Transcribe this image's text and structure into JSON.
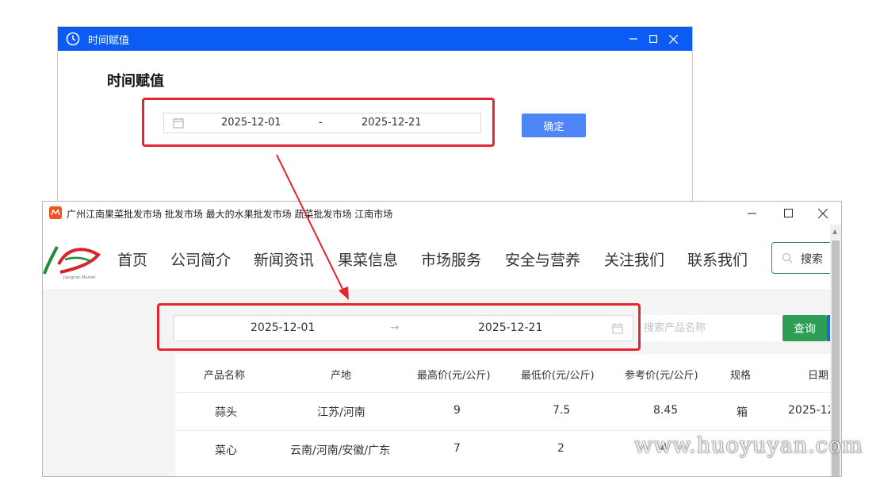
{
  "dialog": {
    "title": "时间赋值",
    "heading": "时间赋值",
    "start_date": "2025-12-01",
    "separator": "-",
    "end_date": "2025-12-21",
    "ok_label": "确定",
    "accent_color": "#0a5cf5"
  },
  "browser": {
    "title": "广州江南果菜批发市场 批发市场 最大的水果批发市场 蔬菜批发市场 江南市场",
    "logo_caption": "Jiangnan Market",
    "nav": [
      "首页",
      "公司简介",
      "新闻资讯",
      "果菜信息",
      "市场服务",
      "安全与营养",
      "关注我们",
      "联系我们"
    ],
    "search_label": "搜索",
    "range": {
      "start": "2025-12-01",
      "arrow": "→",
      "end": "2025-12-21"
    },
    "product_search_placeholder": "搜索产品名称",
    "query_label": "查询",
    "table": {
      "headers": [
        "产品名称",
        "产地",
        "最高价(元/公斤)",
        "最低价(元/公斤)",
        "参考价(元/公斤)",
        "规格",
        "日期"
      ],
      "rows": [
        [
          "蒜头",
          "江苏/河南",
          "9",
          "7.5",
          "8.45",
          "箱",
          "2025-12"
        ],
        [
          "菜心",
          "云南/河南/安徽/广东",
          "7",
          "2",
          "4",
          "",
          ""
        ]
      ]
    }
  },
  "watermark": "www.huoyuyan.com",
  "annotation_color": "#e3262f"
}
